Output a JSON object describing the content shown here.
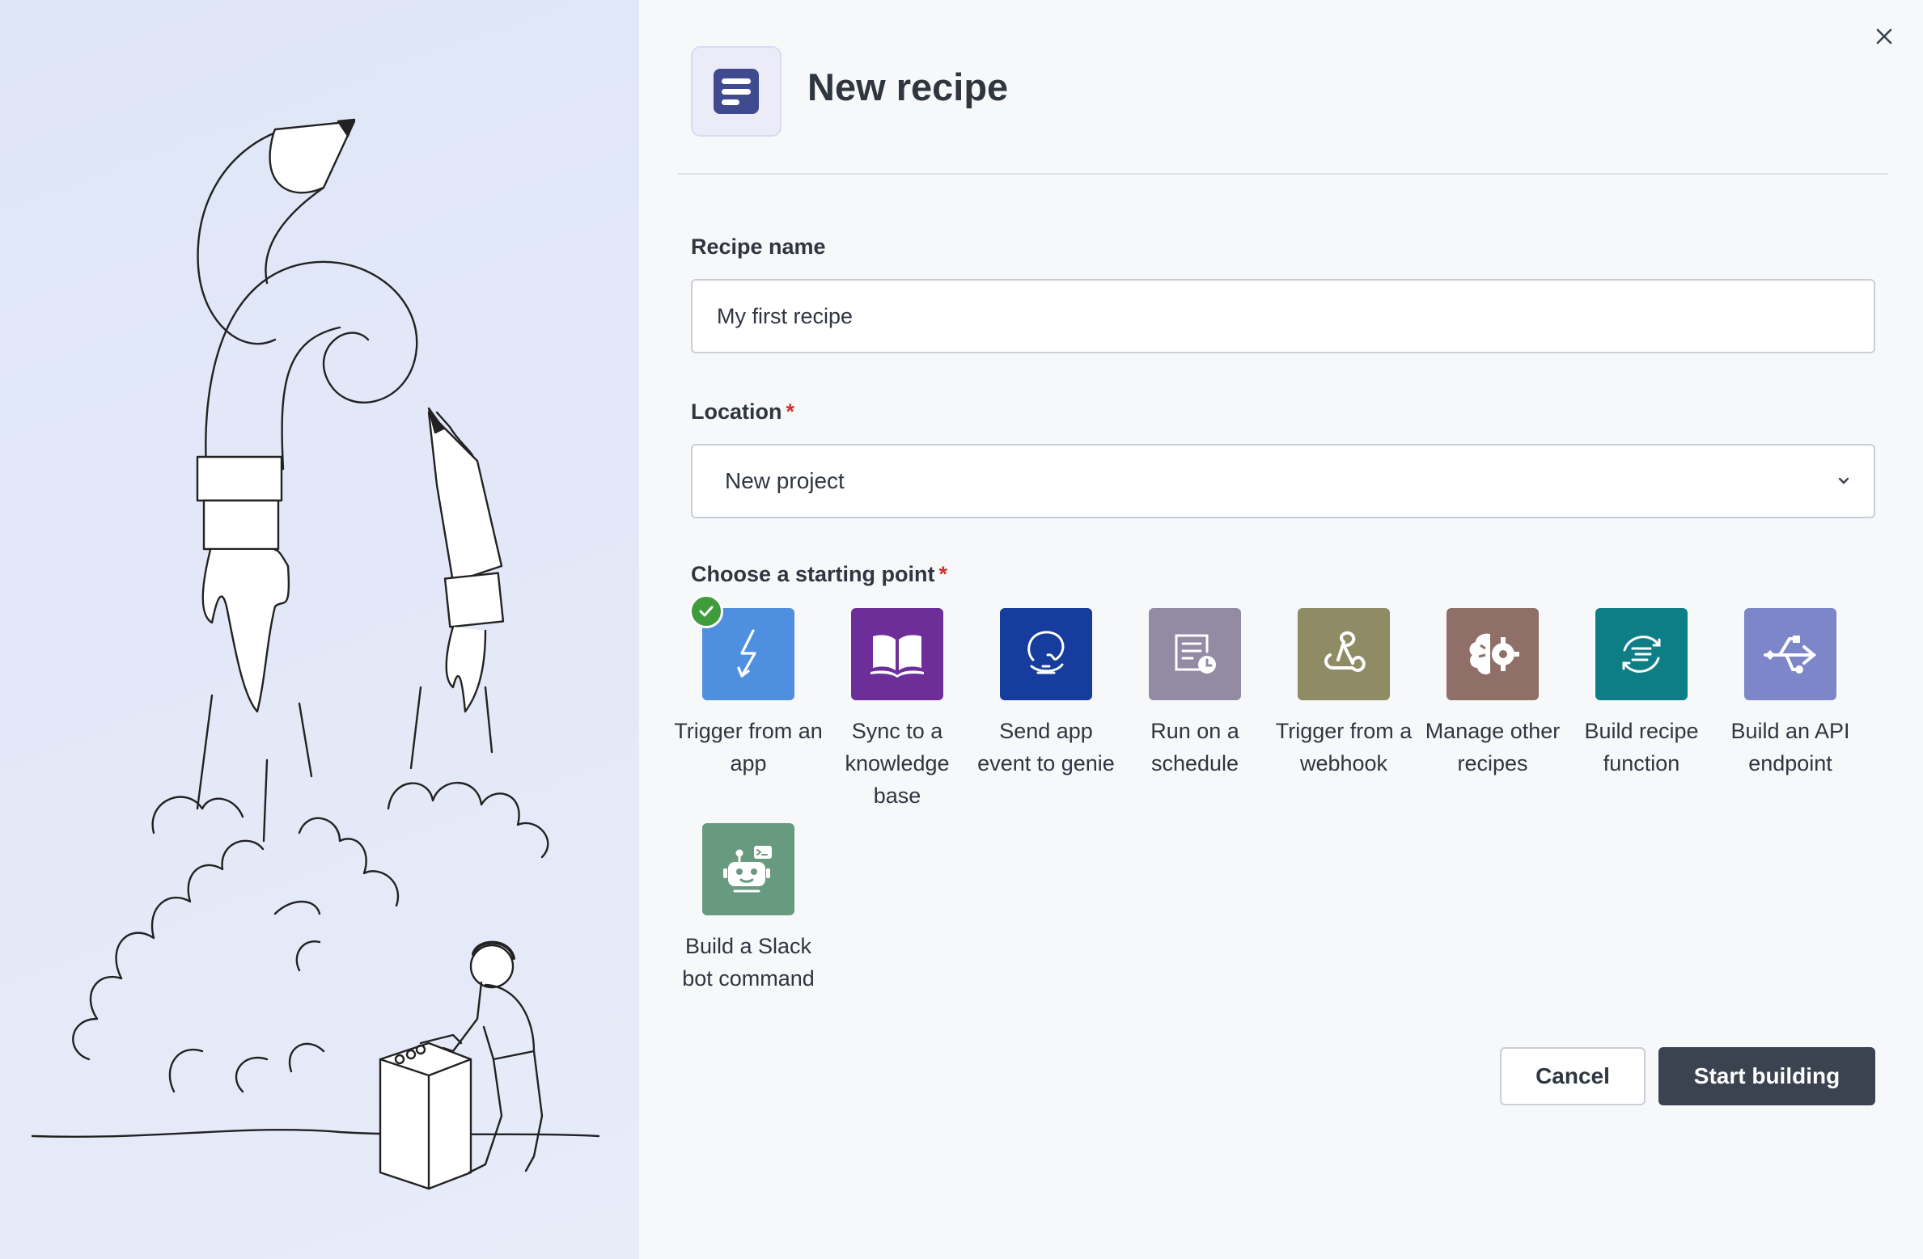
{
  "header": {
    "title": "New recipe",
    "icon": "recipe-icon"
  },
  "form": {
    "recipe_name": {
      "label": "Recipe name",
      "value": "My first recipe"
    },
    "location": {
      "label": "Location",
      "required_mark": "*",
      "value": "New project"
    },
    "starting_point": {
      "label": "Choose a starting point",
      "required_mark": "*"
    }
  },
  "starting_points": [
    {
      "label": "Trigger from an app",
      "icon": "lightning-icon",
      "color": "#4f8fe0",
      "selected": true
    },
    {
      "label": "Sync to a knowledge base",
      "icon": "book-icon",
      "color": "#6e2e9a"
    },
    {
      "label": "Send app event to genie",
      "icon": "genie-icon",
      "color": "#163c9e"
    },
    {
      "label": "Run on a schedule",
      "icon": "schedule-icon",
      "color": "#938aa3"
    },
    {
      "label": "Trigger from a webhook",
      "icon": "webhook-icon",
      "color": "#8f8b64"
    },
    {
      "label": "Manage other recipes",
      "icon": "brain-gear-icon",
      "color": "#8f6f67"
    },
    {
      "label": "Build recipe function",
      "icon": "function-icon",
      "color": "#0e7e86"
    },
    {
      "label": "Build an API endpoint",
      "icon": "api-icon",
      "color": "#7d86c8"
    },
    {
      "label": "Build a Slack bot command",
      "icon": "bot-icon",
      "color": "#689a80"
    }
  ],
  "actions": {
    "cancel": "Cancel",
    "start": "Start building"
  }
}
